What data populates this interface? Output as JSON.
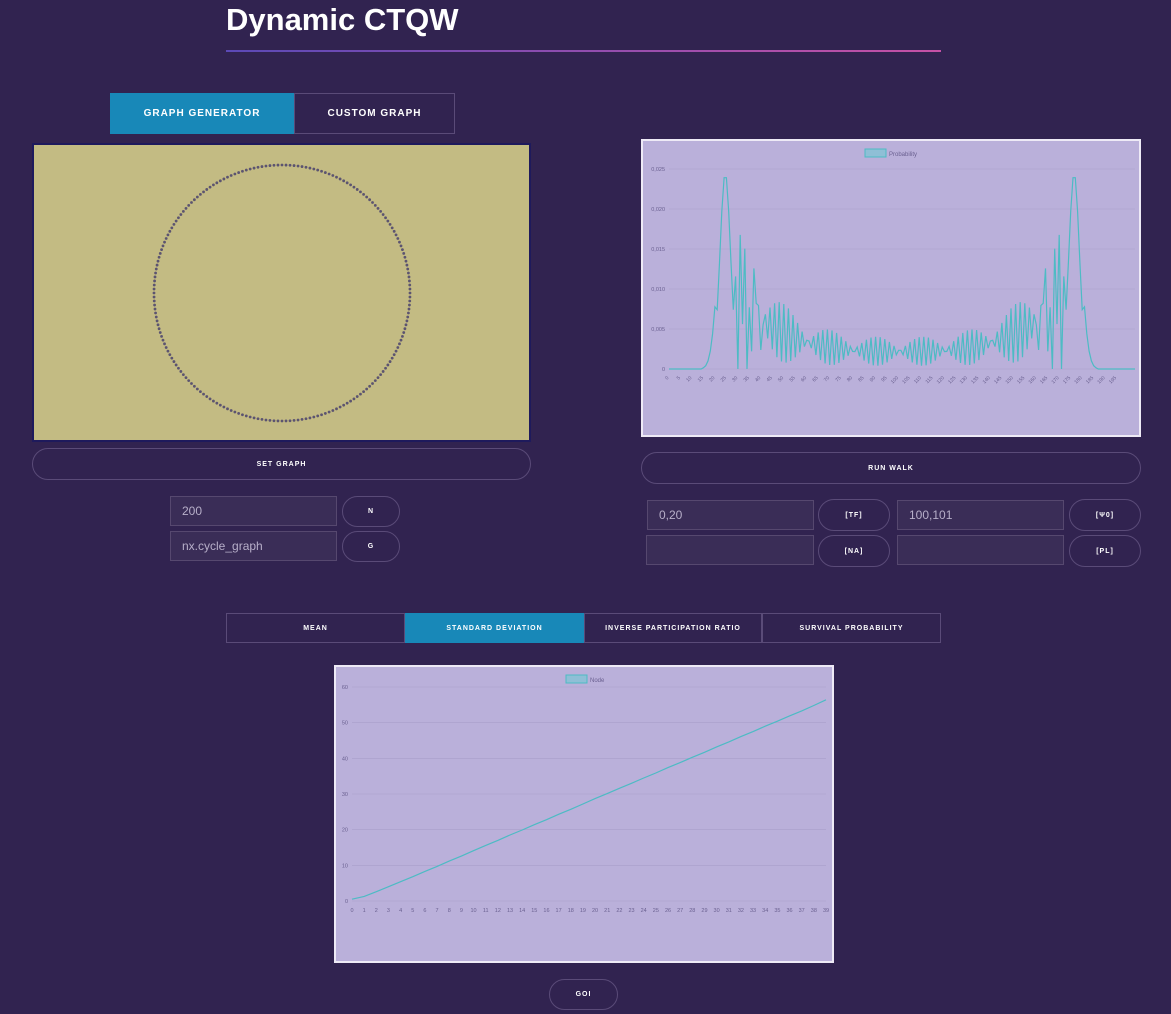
{
  "page": {
    "title": "Dynamic CTQW"
  },
  "graph_tabs": [
    {
      "label": "GRAPH GENERATOR",
      "active": true
    },
    {
      "label": "CUSTOM GRAPH",
      "active": false
    }
  ],
  "graph_panel": {
    "set_graph_label": "SET GRAPH",
    "n_value": "200",
    "n_label": "N",
    "g_value": "nx.cycle_graph",
    "g_label": "G",
    "node_count": 200
  },
  "walk_panel": {
    "run_walk_label": "RUN WALK",
    "tf_value": "0,20",
    "tf_label": "[TF]",
    "psi0_value": "100,101",
    "psi0_label": "[Ψ0]",
    "na_value": "",
    "na_label": "[NA]",
    "pl_value": "",
    "pl_label": "[PL]"
  },
  "stat_tabs": [
    {
      "label": "MEAN",
      "active": false
    },
    {
      "label": "STANDARD DEVIATION",
      "active": true
    },
    {
      "label": "INVERSE PARTICIPATION RATIO",
      "active": false
    },
    {
      "label": "SURVIVAL PROBABILITY",
      "active": false
    }
  ],
  "goi_label": "GOI",
  "colors": {
    "line": "#4dbbc4",
    "accent": "#1888b8",
    "chart_bg": "#bab0da",
    "canvas_bg": "#c3bb83"
  },
  "chart_data": [
    {
      "type": "line",
      "legend": "Probability",
      "legend_position": "top-center",
      "x_from": 0,
      "x_to": 199,
      "x_tick_labels": [
        "0",
        "5",
        "10",
        "15",
        "20",
        "25",
        "30",
        "35",
        "40",
        "45",
        "50",
        "55",
        "60",
        "65",
        "70",
        "75",
        "80",
        "85",
        "90",
        "95",
        "100",
        "105",
        "110",
        "115",
        "120",
        "125",
        "130",
        "135",
        "140",
        "145",
        "150",
        "155",
        "160",
        "165",
        "170",
        "175",
        "180",
        "185",
        "190",
        "195"
      ],
      "y_tick_labels": [
        "0",
        "0,005",
        "0,010",
        "0,015",
        "0,020",
        "0,025"
      ],
      "ylim": [
        0,
        0.026
      ],
      "grid": true,
      "series": [
        {
          "name": "Probability",
          "values": [
            0.0,
            0.0,
            0.0,
            0.0,
            0.0,
            0.0,
            0.0,
            0.0,
            0.0,
            0.0,
            0.0,
            0.0,
            0.0,
            0.0,
            0.0,
            0.0,
            0.0,
            0.0,
            0.0,
            0.0,
            0.0,
            0.0,
            0.0,
            0.0,
            0.0,
            0.0,
            0.0,
            0.0,
            0.0,
            0.0,
            0.0,
            0.0,
            0.0,
            0.0,
            0.0,
            0.0,
            0.0,
            0.0,
            0.0,
            0.0,
            0.0,
            0.0,
            0.0,
            0.0,
            0.0,
            0.0,
            0.0,
            0.0,
            0.0,
            0.0,
            0.0,
            0.0,
            0.0,
            0.0,
            0.0,
            0.0,
            0.0,
            0.0,
            0.0,
            0.0,
            0.0,
            0.0,
            0.0,
            0.0,
            0.0,
            0.0,
            0.0,
            0.0,
            0.0,
            0.0,
            0.0,
            0.0,
            0.0,
            0.0,
            0.0,
            0.0,
            0.0,
            0.0,
            0.0,
            0.0,
            0.0,
            0.0,
            0.0,
            0.0,
            0.0,
            0.0,
            0.0,
            0.0,
            0.0,
            0.0,
            0.0,
            0.0,
            0.0,
            0.0,
            0.0,
            0.0,
            0.0,
            0.0,
            0.0,
            0.0,
            0.0,
            0.0,
            0.0,
            0.0,
            0.0,
            0.0,
            0.0,
            0.0,
            0.0,
            0.0,
            0.0,
            0.0,
            0.0,
            0.0,
            0.0,
            0.0,
            0.0,
            0.0,
            0.0,
            0.0,
            0.0,
            0.0,
            0.0,
            0.0,
            0.0,
            0.0,
            0.0,
            0.0,
            0.0,
            0.0,
            0.0,
            0.0,
            0.0,
            0.0,
            0.0,
            0.0,
            0.0,
            0.0,
            0.0,
            0.0,
            0.0,
            0.0,
            0.0,
            0.0,
            0.0,
            0.0,
            0.0,
            0.0,
            0.0,
            0.0,
            0.0,
            0.0,
            0.0,
            0.0,
            0.0,
            0.0,
            0.0,
            0.0,
            0.0,
            0.0,
            0.0,
            0.0,
            0.0,
            0.0,
            0.0,
            0.0,
            0.0,
            0.0,
            0.0,
            0.0,
            0.0,
            0.0,
            0.0,
            0.0,
            0.0,
            0.0,
            0.0,
            0.0,
            0.0,
            0.0,
            0.0,
            0.0,
            0.0,
            0.0,
            0.0,
            0.0,
            0.0,
            0.0,
            0.0,
            0.0,
            0.0,
            0.0,
            0.0,
            0.0,
            0.0,
            0.0,
            0.0,
            0.0,
            0.0,
            0.0,
            0.0,
            0.0,
            0.0,
            0.0
          ]
        }
      ]
    },
    {
      "type": "line",
      "legend": "Node",
      "legend_position": "top-center",
      "categories": [
        "0",
        "1",
        "2",
        "3",
        "4",
        "5",
        "6",
        "7",
        "8",
        "9",
        "10",
        "11",
        "12",
        "13",
        "14",
        "15",
        "16",
        "17",
        "18",
        "19",
        "20",
        "21",
        "22",
        "23",
        "24",
        "25",
        "26",
        "27",
        "28",
        "29",
        "30",
        "31",
        "32",
        "33",
        "34",
        "35",
        "36",
        "37",
        "38",
        "39"
      ],
      "y_tick_labels": [
        "0",
        "10",
        "20",
        "30",
        "40",
        "50",
        "60"
      ],
      "ylim": [
        0,
        60
      ],
      "grid": true,
      "series": [
        {
          "name": "Node",
          "values": [
            0.5,
            1.3,
            2.6,
            4.0,
            5.4,
            6.8,
            8.3,
            9.7,
            11.2,
            12.6,
            14.1,
            15.6,
            17.0,
            18.5,
            19.9,
            21.4,
            22.8,
            24.3,
            25.7,
            27.2,
            28.7,
            30.1,
            31.6,
            33.0,
            34.5,
            35.9,
            37.4,
            38.8,
            40.3,
            41.7,
            43.2,
            44.6,
            46.1,
            47.5,
            49.0,
            50.4,
            51.9,
            53.3,
            54.8,
            56.4
          ]
        }
      ]
    }
  ]
}
